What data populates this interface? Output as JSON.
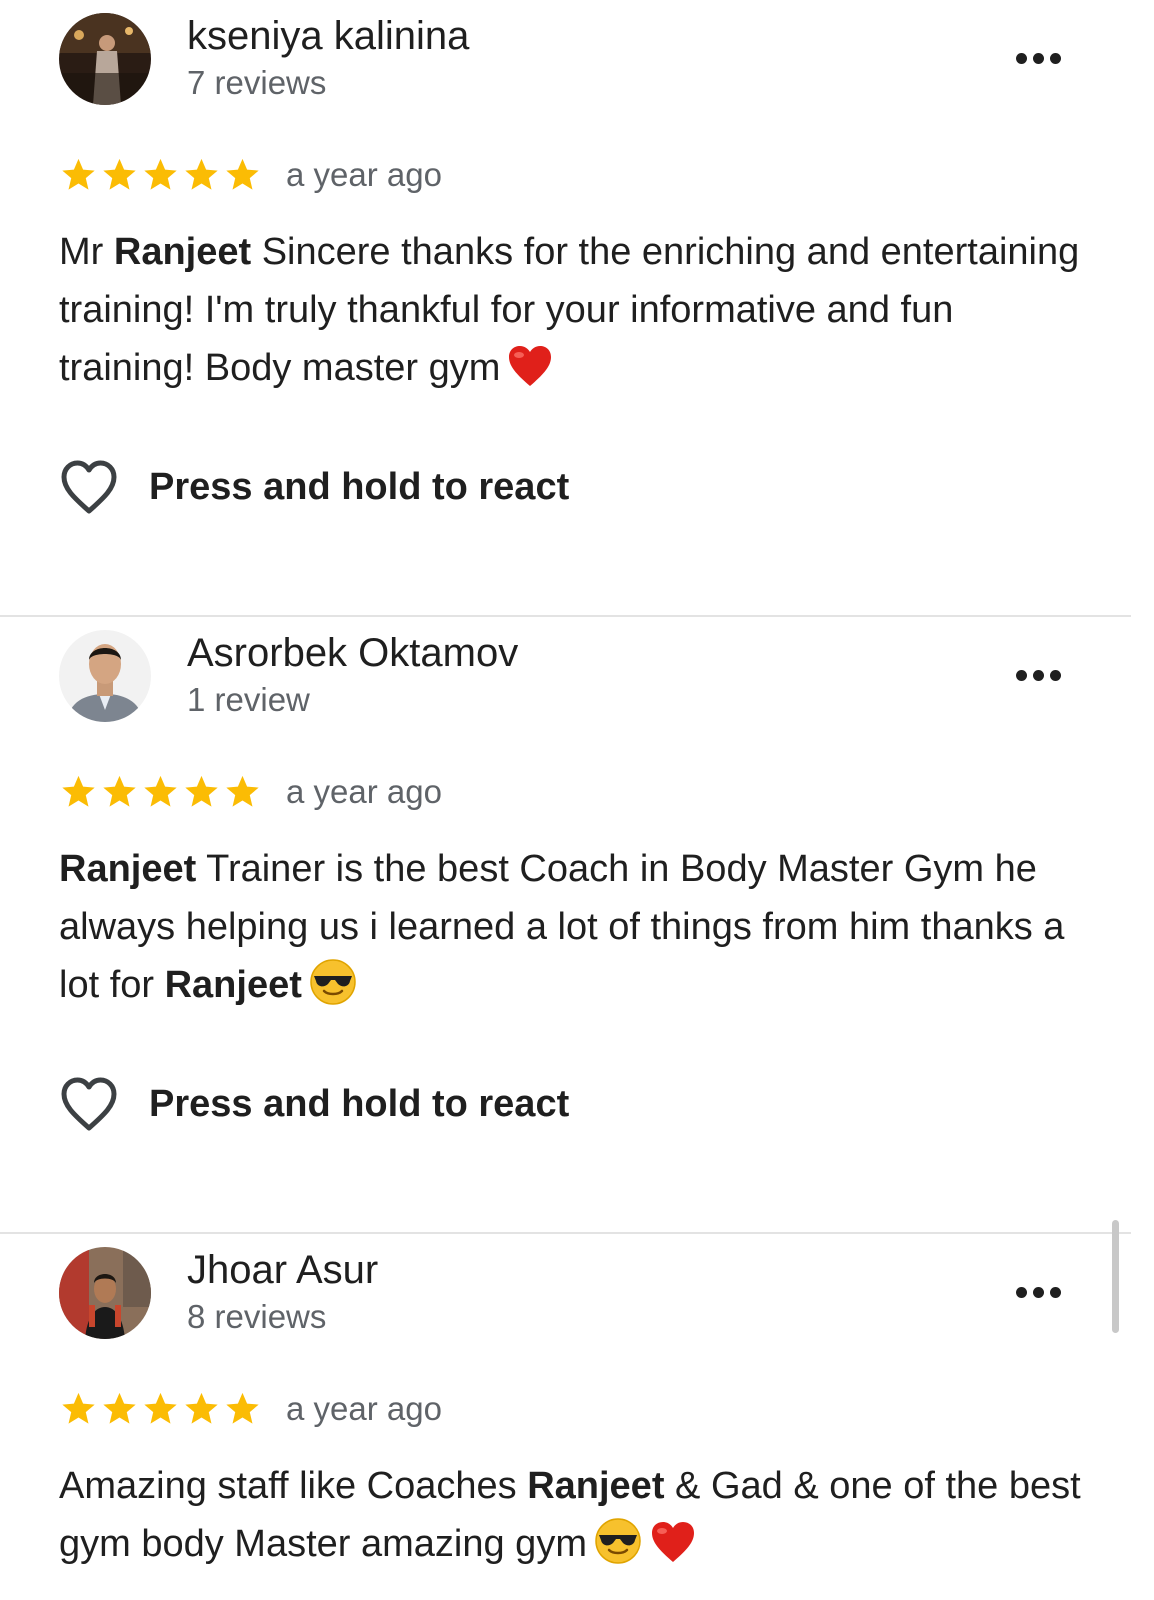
{
  "react_label": "Press and hold to react",
  "star_color": "#fbbc04",
  "reviews": [
    {
      "author": "kseniya kalinina",
      "review_count": "7 reviews",
      "rating": 5,
      "time": "a year ago",
      "text": {
        "p1": "Mr ",
        "h1": "Ranjeet",
        "p2": " Sincere thanks for the enriching and entertaining training! I'm truly thankful for your informative and fun training! Body master gym"
      },
      "emojis": [
        "red-heart"
      ]
    },
    {
      "author": "Asrorbek Oktamov",
      "review_count": "1 review",
      "rating": 5,
      "time": "a year ago",
      "text": {
        "h1": "Ranjeet",
        "p1": " Trainer is the best Coach in Body Master Gym he always helping us i learned a lot of things from him thanks a lot for ",
        "h2": "Ranjeet"
      },
      "emojis": [
        "sunglasses-face"
      ]
    },
    {
      "author": "Jhoar Asur",
      "review_count": "8 reviews",
      "rating": 5,
      "time": "a year ago",
      "text": {
        "p1": "Amazing staff like Coaches ",
        "h1": "Ranjeet",
        "p2": " & Gad & one of the best gym body Master amazing gym"
      },
      "emojis": [
        "sunglasses-face",
        "red-heart"
      ]
    }
  ]
}
